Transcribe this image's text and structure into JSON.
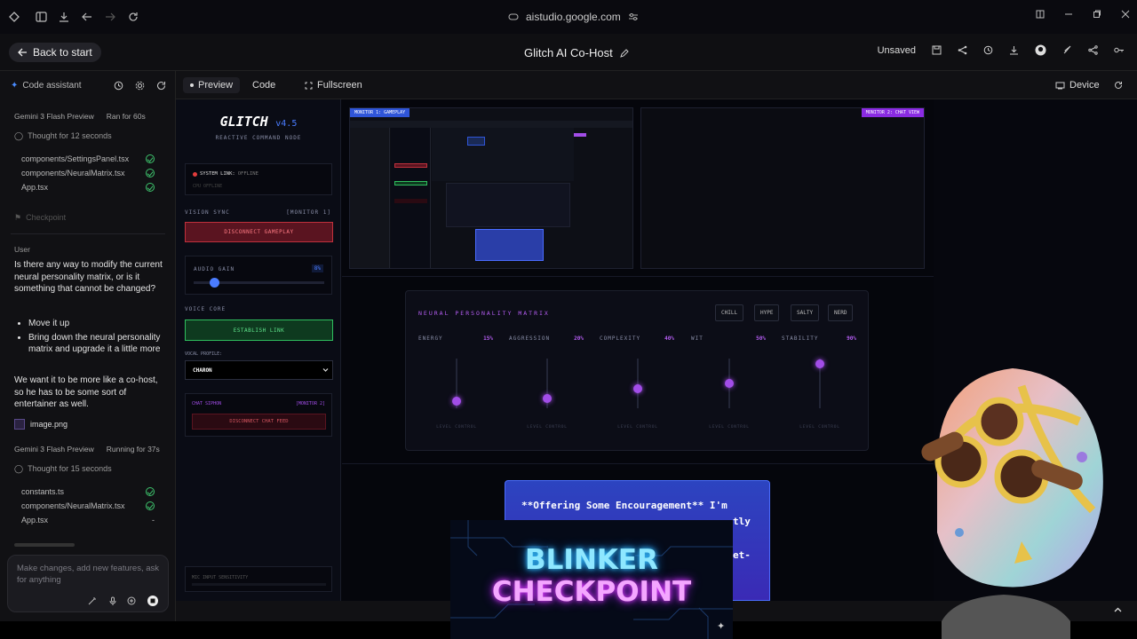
{
  "browser": {
    "url": "aistudio.google.com"
  },
  "header": {
    "back_label": "Back to start",
    "title": "Glitch AI Co-Host",
    "unsaved": "Unsaved"
  },
  "left": {
    "panel_title": "Code assistant",
    "run1_model": "Gemini 3 Flash Preview",
    "run1_status": "Ran for 60s",
    "thought1": "Thought for 12 seconds",
    "files1": [
      "components/SettingsPanel.tsx",
      "components/NeuralMatrix.tsx",
      "App.tsx"
    ],
    "checkpoint": "Checkpoint",
    "user_label": "User",
    "msg_q": "Is there any way to modify the current neural personality matrix, or is it something that cannot be changed?",
    "bullets": [
      "Move it up",
      "Bring down the neural personality matrix and upgrade it a little more"
    ],
    "msg2": "We want it to be more like a co-host, so he has to be some sort of entertainer as well.",
    "attachment": "image.png",
    "run2_model": "Gemini 3 Flash Preview",
    "run2_status": "Running for 37s",
    "thought2": "Thought for 15 seconds",
    "files2": [
      "constants.ts",
      "components/NeuralMatrix.tsx",
      "App.tsx"
    ],
    "file2_last_mark": "-",
    "input_placeholder": "Make changes, add new features, ask for anything"
  },
  "tabs": {
    "preview": "Preview",
    "code": "Code",
    "fullscreen": "Fullscreen",
    "device": "Device"
  },
  "control": {
    "logo": "GLITCH",
    "version": "v4.5",
    "subtitle": "REACTIVE COMMAND NODE",
    "system_link": "SYSTEM LINK:",
    "system_state": "OFFLINE",
    "cpu_line": "CPU OFFLINE",
    "vision_sync": "VISION SYNC",
    "vision_monitor": "[MONITOR 1]",
    "disconnect_gameplay": "DISCONNECT GAMEPLAY",
    "audio_gain": "AUDIO GAIN",
    "audio_value": "8%",
    "audio_level": 0.08,
    "voice_core": "VOICE CORE",
    "establish_link": "ESTABLISH LINK",
    "vocal_profile_label": "VOCAL PROFILE:",
    "vocal_profile": "CHARON",
    "chat_siphon": "CHAT SIPHON",
    "chat_monitor": "[MONITOR 2]",
    "disconnect_chat": "DISCONNECT CHAT FEED",
    "mic_label": "MIC INPUT SENSITIVITY"
  },
  "monitors": {
    "m1": "MONITOR 1: GAMEPLAY",
    "m2": "MONITOR 2: CHAT VIEW"
  },
  "matrix": {
    "title": "NEURAL PERSONALITY MATRIX",
    "presets": [
      "CHILL",
      "HYPE",
      "SALTY",
      "NERD"
    ],
    "sliders": [
      {
        "name": "ENERGY",
        "value": "15%",
        "level": 0.15
      },
      {
        "name": "AGGRESSION",
        "value": "20%",
        "level": 0.2
      },
      {
        "name": "COMPLEXITY",
        "value": "40%",
        "level": 0.4
      },
      {
        "name": "WIT",
        "value": "50%",
        "level": 0.5
      },
      {
        "name": "STABILITY",
        "value": "90%",
        "level": 0.9
      }
    ],
    "level_caption": "LEVEL CONTROL"
  },
  "bubble": {
    "line1": "**Offering Some Encouragement** I'm",
    "line2": "tly",
    "line3": "et-"
  },
  "banner": {
    "line1": "BLINKER",
    "line2": "CHECKPOINT"
  },
  "colors": {
    "accent_red": "#c0313c",
    "accent_green": "#2fbf5e",
    "accent_purple": "#a24de8",
    "accent_blue": "#2f55d8"
  }
}
